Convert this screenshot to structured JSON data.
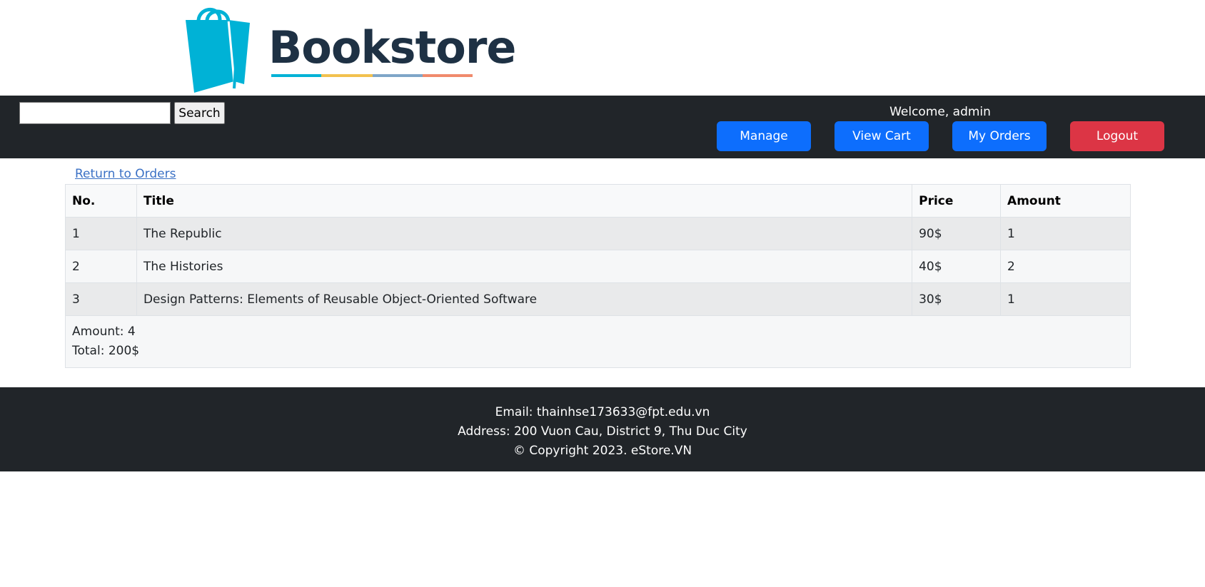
{
  "brand": {
    "name": "Bookstore",
    "colors": {
      "bag": "#00b2d6",
      "text": "#1e3144",
      "stripe": [
        "#00b2d6",
        "#f2c14e",
        "#7fa6c8",
        "#f08a6c"
      ]
    }
  },
  "search": {
    "value": "",
    "placeholder": "",
    "button_label": "Search"
  },
  "nav": {
    "welcome": "Welcome, admin",
    "buttons": {
      "manage": "Manage",
      "view_cart": "View Cart",
      "my_orders": "My Orders",
      "logout": "Logout"
    }
  },
  "main": {
    "return_link": "Return to Orders",
    "table": {
      "headers": {
        "no": "No.",
        "title": "Title",
        "price": "Price",
        "amount": "Amount"
      },
      "rows": [
        {
          "no": "1",
          "title": "The Republic",
          "price": "90$",
          "amount": "1"
        },
        {
          "no": "2",
          "title": "The Histories",
          "price": "40$",
          "amount": "2"
        },
        {
          "no": "3",
          "title": "Design Patterns: Elements of Reusable Object-Oriented Software",
          "price": "30$",
          "amount": "1"
        }
      ],
      "summary": {
        "amount": "Amount: 4",
        "total": "Total: 200$"
      }
    }
  },
  "footer": {
    "email": "Email: thainhse173633@fpt.edu.vn",
    "address": "Address: 200 Vuon Cau, District 9, Thu Duc City",
    "copyright": "© Copyright 2023. eStore.VN"
  },
  "colors": {
    "dark": "#212529",
    "primary": "#0d6efd",
    "danger": "#dc3545"
  }
}
